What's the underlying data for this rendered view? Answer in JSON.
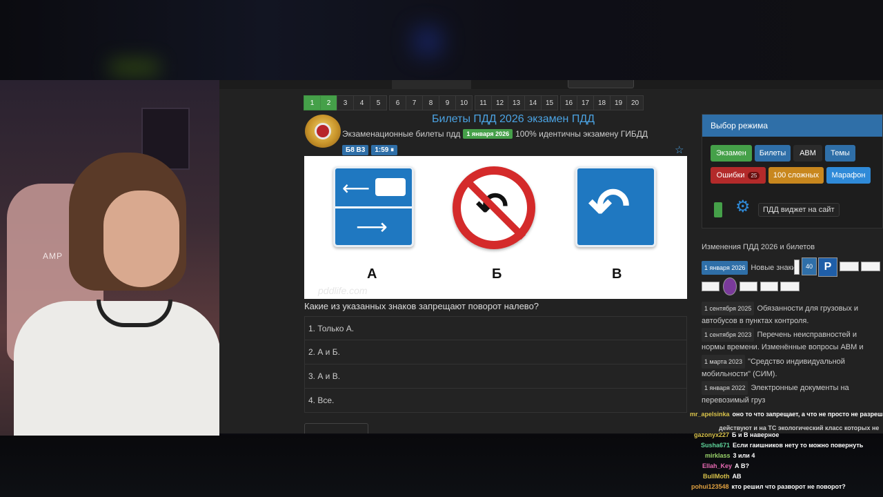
{
  "pager": {
    "groups": [
      [
        "1",
        "2",
        "3",
        "4",
        "5"
      ],
      [
        "6",
        "7",
        "8",
        "9",
        "10"
      ],
      [
        "11",
        "12",
        "13",
        "14",
        "15"
      ],
      [
        "16",
        "17",
        "18",
        "19",
        "20"
      ]
    ],
    "active": [
      "1",
      "2"
    ]
  },
  "header": {
    "title": "Билеты ПДД 2026 экзамен ПДД",
    "subtitle_prefix": "Экзаменационные билеты пдд",
    "date_badge": "1 января 2026",
    "subtitle_suffix": "100% идентичны экзамену ГИБДД",
    "ticket_chip": "Б8 В3",
    "timer_chip": "1:59 ⏸"
  },
  "question": {
    "sign_labels": [
      "А",
      "Б",
      "В"
    ],
    "watermark": "pddlife.com",
    "text": "Какие из указанных знаков запрещают поворот налево?",
    "answers": [
      "1. Только А.",
      "2. А и Б.",
      "3. А и В.",
      "4. Все."
    ]
  },
  "mode": {
    "header": "Выбор режима",
    "buttons": [
      {
        "label": "Экзамен",
        "color": "#45a049"
      },
      {
        "label": "Билеты",
        "color": "#2f6fa8"
      },
      {
        "label": "ABM",
        "color": "#2b2b2b"
      },
      {
        "label": "Темы",
        "color": "#2f6fa8"
      },
      {
        "label": "Ошибки",
        "count": "25",
        "color": "#b32a2a"
      },
      {
        "label": "100 сложных",
        "color": "#c8871e"
      },
      {
        "label": "Марафон",
        "color": "#2f8ad8"
      }
    ],
    "widget": "ПДД виджет на сайт"
  },
  "changes": {
    "heading": "Изменения ПДД 2026 и билетов",
    "items": [
      {
        "date": "1 января 2026",
        "text": "Новые знаки"
      },
      {
        "date": "1 сентября 2025",
        "text": "Обязанности для грузовых и автобусов в пунктах контроля."
      },
      {
        "date": "1 сентября 2023",
        "text": "Перечень неисправностей и нормы времени. Изменённые вопросы ABM и CD."
      },
      {
        "date": "1 марта 2023",
        "text": "\"Средство индивидуальной мобильности\" (СИМ)."
      },
      {
        "date": "1 января 2022",
        "text": "Электронные документы на перевозимый груз"
      }
    ],
    "sign_40": "40",
    "sign_p": "P"
  },
  "chat": [
    {
      "user": "mr_apelsinka",
      "msg": "оно то что запрещает, а что не просто не разрешает",
      "color": "#d8c24a"
    },
    {
      "user": "",
      "msg": "действуют и на ТС экологический класс которых не",
      "color": "#cccccc"
    },
    {
      "user": "gazonyx227",
      "msg": "Б и В наверное",
      "color": "#d8c24a"
    },
    {
      "user": "Susha671",
      "msg": "Если гаишников нету то можно повернуть",
      "color": "#5fd39a"
    },
    {
      "user": "mirklass",
      "msg": "3 или 4",
      "color": "#9ad36a"
    },
    {
      "user": "Ellah_Key",
      "msg": "А В?",
      "color": "#e86ab3"
    },
    {
      "user": "BullMoth",
      "msg": "АВ",
      "color": "#d8c24a"
    },
    {
      "user": "pohui123548",
      "msg": "кто решил что разворот не поворот?",
      "color": "#e0a040"
    }
  ],
  "webcam": {
    "chair_text": "AMP"
  }
}
